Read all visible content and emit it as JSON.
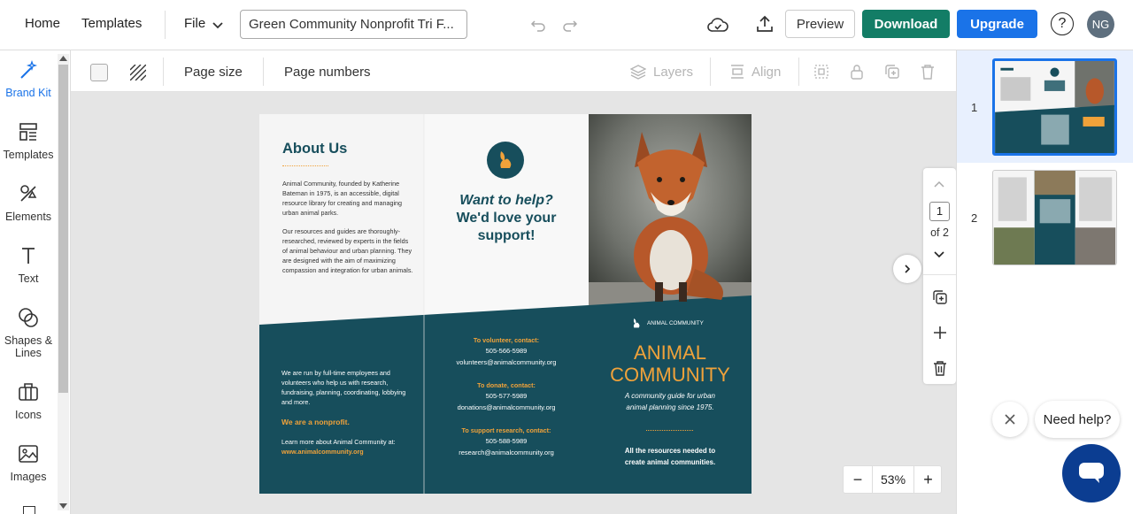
{
  "topbar": {
    "home": "Home",
    "templates": "Templates",
    "file": "File",
    "doc_title": "Green Community Nonprofit Tri F...",
    "preview": "Preview",
    "download": "Download",
    "upgrade": "Upgrade",
    "avatar": "NG"
  },
  "sidebar": {
    "items": [
      {
        "label": "Brand Kit"
      },
      {
        "label": "Templates"
      },
      {
        "label": "Elements"
      },
      {
        "label": "Text"
      },
      {
        "label": "Shapes &"
      },
      {
        "label": "Lines"
      },
      {
        "label": "Icons"
      },
      {
        "label": "Images"
      }
    ]
  },
  "toolbar": {
    "page_size": "Page size",
    "page_numbers": "Page numbers",
    "layers": "Layers",
    "align": "Align"
  },
  "pager": {
    "current": "1",
    "of": "of 2"
  },
  "zoom": {
    "value": "53",
    "unit": "%"
  },
  "pages_panel": {
    "page1": "1",
    "page2": "2"
  },
  "help": {
    "text": "Need help?"
  },
  "brochure": {
    "about_title": "About Us",
    "about_p1": "Animal Community, founded by Katherine Bateman in 1975, is an accessible, digital resource library for creating and managing urban animal parks.",
    "about_p2": "Our resources and guides are thoroughly-researched, reviewed by experts in the fields of animal behaviour and urban planning. They are designed with the aim of maximizing compassion and integration for urban animals.",
    "want_line1": "Want to help?",
    "want_line2": "We'd love your",
    "want_line3": "support!",
    "staff_text": "We are run by full-time employees and volunteers who help us with research, fundraising, planning, coordinating, lobbying and more.",
    "nonprofit": "We are a nonprofit.",
    "learn_more": "Learn more about Animal Community at:",
    "website": "www.animalcommunity.org",
    "volunteer_label": "To volunteer, contact:",
    "volunteer_phone": "505-566-5989",
    "volunteer_email": "volunteers@animalcommunity.org",
    "donate_label": "To donate, contact:",
    "donate_phone": "505-577-5989",
    "donate_email": "donations@animalcommunity.org",
    "research_label": "To support research, contact:",
    "research_phone": "505-588-5989",
    "research_email": "research@animalcommunity.org",
    "logo_text": "ANIMAL COMMUNITY",
    "big_title_1": "ANIMAL",
    "big_title_2": "COMMUNITY",
    "tagline_1": "A community guide for urban",
    "tagline_2": "animal planning since 1975.",
    "closing_1": "All the resources needed to",
    "closing_2": "create animal communities."
  },
  "colors": {
    "teal": "#174e5c",
    "orange": "#f0a23a",
    "download": "#137d66",
    "upgrade": "#1a73e8"
  }
}
